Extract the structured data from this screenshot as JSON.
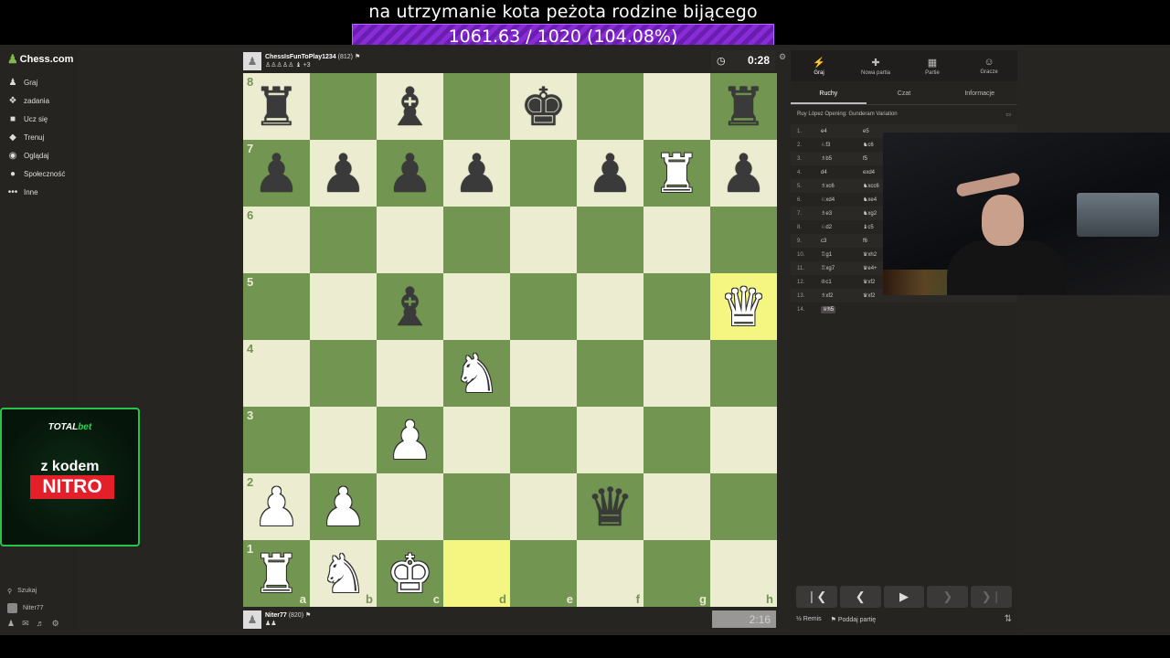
{
  "overlay": {
    "title": "na utrzymanie kota peżota rodzine bijącego",
    "progress_text": "1061.63 / 1020 (104.08%)",
    "progress_value": 104.08
  },
  "sidebar": {
    "logo_text": "Chess.com",
    "items": [
      {
        "label": "Graj",
        "icon": "♟"
      },
      {
        "label": "zadania",
        "icon": "❖"
      },
      {
        "label": "Ucz się",
        "icon": "■"
      },
      {
        "label": "Trenuj",
        "icon": "◆"
      },
      {
        "label": "Oglądaj",
        "icon": "◉"
      },
      {
        "label": "Społeczność",
        "icon": "●"
      },
      {
        "label": "Inne",
        "icon": "•••"
      }
    ],
    "search_label": "Szukaj",
    "user_label": "Niter77"
  },
  "ad": {
    "brand_a": "TOTAL",
    "brand_b": "bet",
    "line1": "z kodem",
    "line2": "NITRO"
  },
  "top_player": {
    "name": "ChessIsFunToPlay1234",
    "rating": "(812)",
    "captured_note": "+3",
    "clock": "0:28"
  },
  "bottom_player": {
    "name": "Niter77",
    "rating": "(820)",
    "clock": "2:16"
  },
  "board": {
    "ranks": [
      "8",
      "7",
      "6",
      "5",
      "4",
      "3",
      "2",
      "1"
    ],
    "files": [
      "a",
      "b",
      "c",
      "d",
      "e",
      "f",
      "g",
      "h"
    ],
    "rows": [
      [
        "bR",
        "",
        "bB",
        "",
        "bK",
        "",
        "",
        "bR"
      ],
      [
        "bP",
        "bP",
        "bP",
        "bP",
        "",
        "bP",
        "wR",
        "bP"
      ],
      [
        "",
        "",
        "",
        "",
        "",
        "",
        "",
        ""
      ],
      [
        "",
        "",
        "bB",
        "",
        "",
        "",
        "",
        "wQ"
      ],
      [
        "",
        "",
        "",
        "wN",
        "",
        "",
        "",
        ""
      ],
      [
        "",
        "",
        "wP",
        "",
        "",
        "",
        "",
        ""
      ],
      [
        "wP",
        "wP",
        "",
        "",
        "",
        "bQ",
        "",
        ""
      ],
      [
        "wR",
        "wN",
        "wK",
        "",
        "",
        "",
        "",
        ""
      ]
    ],
    "highlight": [
      "d1",
      "h5"
    ]
  },
  "panel": {
    "tabs": [
      {
        "label": "Graj",
        "icon": "⚡"
      },
      {
        "label": "Nowa partia",
        "icon": "✚"
      },
      {
        "label": "Partie",
        "icon": "▦"
      },
      {
        "label": "Gracze",
        "icon": "☺"
      }
    ],
    "subtabs": [
      "Ruchy",
      "Czat",
      "Informacje"
    ],
    "opening": "Ruy López Opening: Gunderam Variation",
    "moves": [
      {
        "n": "1.",
        "w": "e4",
        "b": "e5"
      },
      {
        "n": "2.",
        "w": "♘f3",
        "b": "♞c6"
      },
      {
        "n": "3.",
        "w": "♗b5",
        "b": "f5"
      },
      {
        "n": "4.",
        "w": "d4",
        "b": "exd4"
      },
      {
        "n": "5.",
        "w": "♗xc6",
        "b": "♞xcc6"
      },
      {
        "n": "6.",
        "w": "♘xd4",
        "b": "♞xe4"
      },
      {
        "n": "7.",
        "w": "♗e3",
        "b": "♞xg2"
      },
      {
        "n": "8.",
        "w": "♘d2",
        "b": "♝c5"
      },
      {
        "n": "9.",
        "w": "c3",
        "b": "f6"
      },
      {
        "n": "10.",
        "w": "♖g1",
        "b": "♛xh2"
      },
      {
        "n": "11.",
        "w": "♖xg7",
        "b": "♛e4+"
      },
      {
        "n": "12.",
        "w": "♔c1",
        "b": "♛xf2"
      },
      {
        "n": "13.",
        "w": "♗xf2",
        "b": "♛xf2"
      },
      {
        "n": "14.",
        "w": "♕h5",
        "b": ""
      }
    ],
    "draw_label": "Remis",
    "draw_prefix": "½",
    "resign_label": "Poddaj partię"
  },
  "colors": {
    "light_square": "#ebecd0",
    "dark_square": "#739552",
    "highlight": "#f5f682",
    "accent": "#81b64c"
  }
}
